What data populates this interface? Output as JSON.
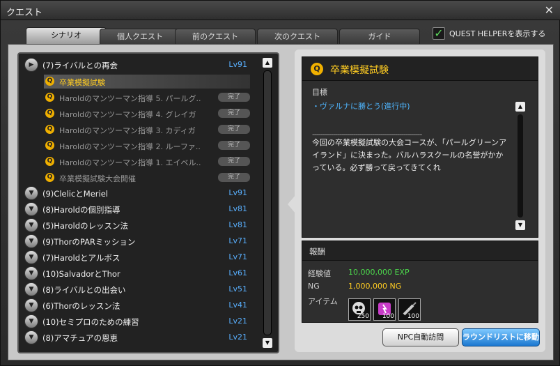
{
  "window": {
    "title": "クエスト"
  },
  "tabs": [
    "シナリオ",
    "個人クエスト",
    "前のクエスト",
    "次のクエスト",
    "ガイド"
  ],
  "quest_helper": {
    "label": "QUEST HELPERを表示する",
    "checked": true
  },
  "list": {
    "expanded_group": {
      "name": "(7)ライバルとの再会",
      "lv": "Lv91"
    },
    "sub_quests": [
      {
        "name": "卒業模擬試験",
        "done": ""
      },
      {
        "name": "Haroldのマンツーマン指導 5. パールグ..",
        "done": "完了"
      },
      {
        "name": "Haroldのマンツーマン指導 4. グレイガ",
        "done": "完了"
      },
      {
        "name": "Haroldのマンツーマン指導 3. カディガ",
        "done": "完了"
      },
      {
        "name": "Haroldのマンツーマン指導 2. ルーファ..",
        "done": "完了"
      },
      {
        "name": "Haroldのマンツーマン指導 1. エイベル..",
        "done": "完了"
      },
      {
        "name": "卒業模擬試験大会開催",
        "done": "完了"
      }
    ],
    "groups": [
      {
        "name": "(9)ClelicとMeriel",
        "lv": "Lv91"
      },
      {
        "name": "(8)Haroldの個別指導",
        "lv": "Lv81"
      },
      {
        "name": "(5)Haroldのレッスン法",
        "lv": "Lv81"
      },
      {
        "name": "(9)ThorのPARミッション",
        "lv": "Lv71"
      },
      {
        "name": "(7)Haroldとアルボス",
        "lv": "Lv71"
      },
      {
        "name": "(10)SalvadorとThor",
        "lv": "Lv61"
      },
      {
        "name": "(8)ライバルとの出会い",
        "lv": "Lv51"
      },
      {
        "name": "(6)Thorのレッスン法",
        "lv": "Lv41"
      },
      {
        "name": "(10)セミプロのための練習",
        "lv": "Lv21"
      },
      {
        "name": "(8)アマチュアの恩恵",
        "lv": "Lv21"
      }
    ]
  },
  "detail": {
    "title": "卒業模擬試験",
    "objective_label": "目標",
    "objective": "・ヴァルナに勝とう(進行中)",
    "divider": "-----------------------------------------------------",
    "body": "今回の卒業模擬試験の大会コースが、「パールグリーンアイランド」に決まった。バルハラスクールの名誉がかかっている。必ず勝って戻ってきてくれ"
  },
  "reward": {
    "title": "報酬",
    "exp_label": "経験値",
    "exp_value": "10,000,000 EXP",
    "ng_label": "NG",
    "ng_value": "1,000,000 NG",
    "item_label": "アイテム",
    "items": [
      {
        "icon": "skull-ball-icon",
        "count": "250"
      },
      {
        "icon": "pink-card-icon",
        "count": "100"
      },
      {
        "icon": "syringe-icon",
        "count": "100"
      }
    ]
  },
  "buttons": {
    "npc": "NPC自動訪問",
    "round": "ラウンドリストに移動"
  },
  "colors": {
    "level": "#59b0ff",
    "exp": "#4cd84c",
    "ng": "#ffcc22",
    "selected": "#ffcc22",
    "objective": "#4fb6ff"
  }
}
